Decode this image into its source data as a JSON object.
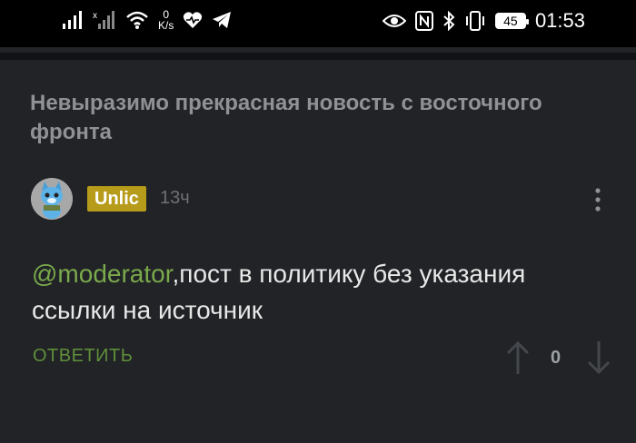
{
  "status_bar": {
    "speed_value": "0",
    "speed_unit": "K/s",
    "battery": "45",
    "time": "01:53"
  },
  "post": {
    "title": "Невыразимо прекрасная новость с восточного фронта"
  },
  "comment": {
    "author": "Unlic",
    "time": "13ч",
    "mention": "@moderator",
    "text": ",пост в политику без указания ссылки на источник",
    "reply_label": "ОТВЕТИТЬ",
    "score": "0"
  },
  "colors": {
    "background": "#212326",
    "author_badge": "#b79b1b",
    "mention": "#7aa94c",
    "reply": "#5f8f3a"
  }
}
